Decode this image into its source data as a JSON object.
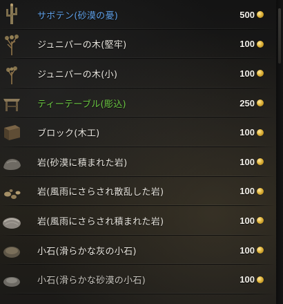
{
  "items": [
    {
      "name": "サボテン(砂漠の憂)",
      "price": "500",
      "name_color": "#5fa0e8",
      "icon": "cactus-icon"
    },
    {
      "name": "ジュニパーの木(堅牢)",
      "price": "100",
      "name_color": "#e9e6df",
      "icon": "juniper-tree-icon"
    },
    {
      "name": "ジュニパーの木(小)",
      "price": "100",
      "name_color": "#e9e6df",
      "icon": "juniper-tree-small-icon"
    },
    {
      "name": "ティーテーブル(彫込)",
      "price": "250",
      "name_color": "#6cc943",
      "icon": "tea-table-icon"
    },
    {
      "name": "ブロック(木工)",
      "price": "100",
      "name_color": "#e9e6df",
      "icon": "wood-block-icon"
    },
    {
      "name": "岩(砂漠に積まれた岩)",
      "price": "100",
      "name_color": "#e9e6df",
      "icon": "desert-rock-icon"
    },
    {
      "name": "岩(風雨にさらされ散乱した岩)",
      "price": "100",
      "name_color": "#e9e6df",
      "icon": "scattered-rocks-icon"
    },
    {
      "name": "岩(風雨にさらされ積まれた岩)",
      "price": "100",
      "name_color": "#e9e6df",
      "icon": "stacked-rock-icon"
    },
    {
      "name": "小石(滑らかな灰の小石)",
      "price": "100",
      "name_color": "#e9e6df",
      "icon": "gray-pebble-icon"
    },
    {
      "name": "小石(滑らかな砂漠の小石)",
      "price": "100",
      "name_color": "#c9c6bf",
      "icon": "desert-pebble-icon"
    }
  ],
  "currency_icon": "gold-coin-icon"
}
